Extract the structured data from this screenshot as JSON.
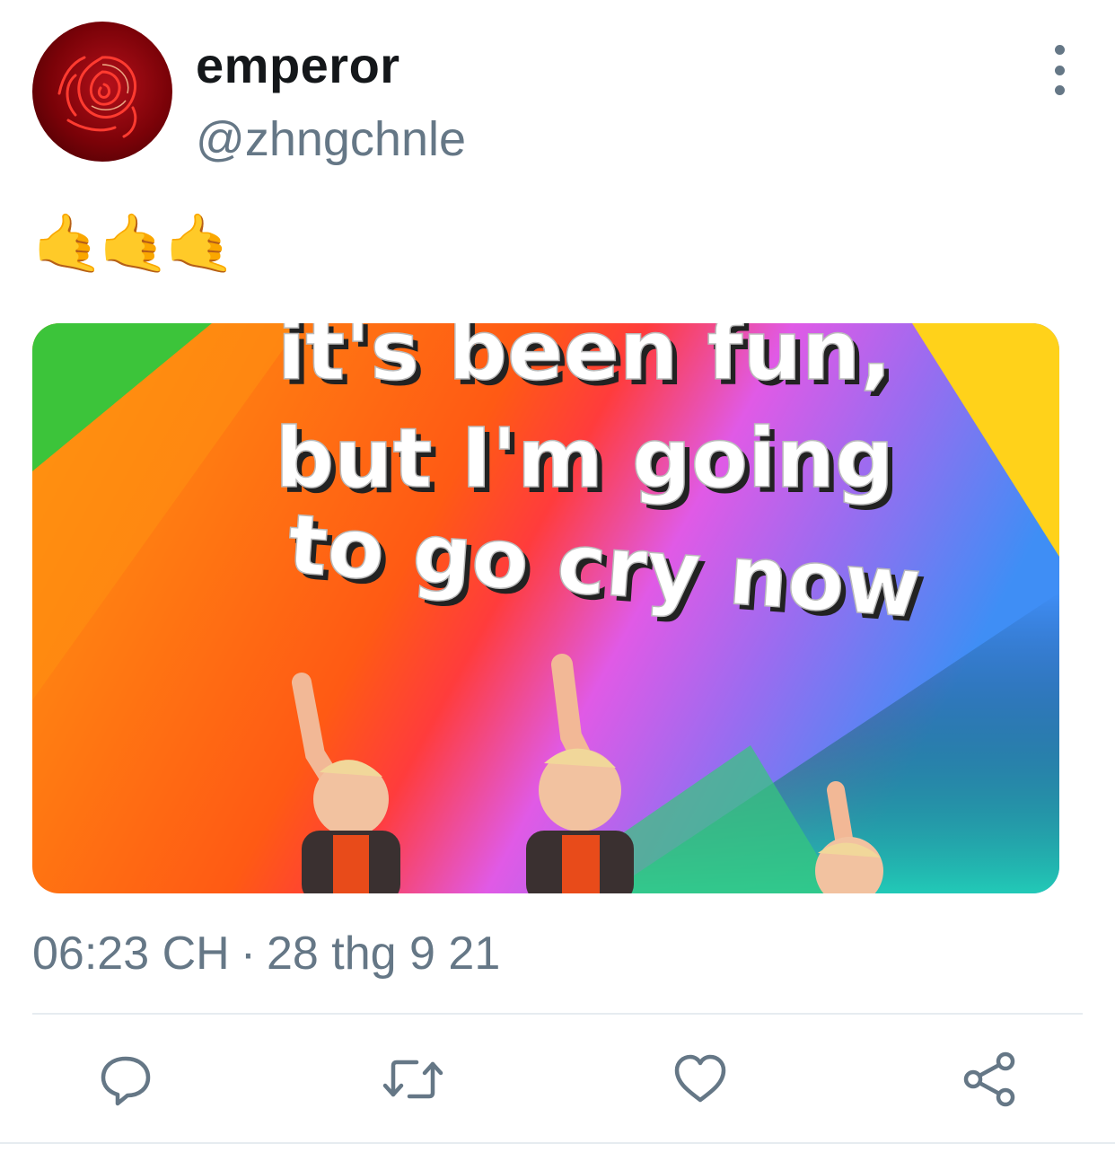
{
  "tweet": {
    "display_name": "emperor",
    "handle": "@zhngchnle",
    "text": "🤙🤙🤙",
    "timestamp": {
      "time": "06:23 CH",
      "separator": "·",
      "date": "28 thg 9 21"
    }
  },
  "media": {
    "caption_lines": [
      "it's been fun,",
      "but I'm going",
      "to go cry now"
    ]
  },
  "icons": {
    "avatar": "red-rose-avatar",
    "more": "more-vertical-icon",
    "reply": "reply-icon",
    "retweet": "retweet-icon",
    "like": "heart-icon",
    "share": "share-icon"
  },
  "colors": {
    "text_primary": "#14171a",
    "text_secondary": "#657786",
    "divider": "#e6ecf0",
    "emoji": "#f2b728"
  }
}
